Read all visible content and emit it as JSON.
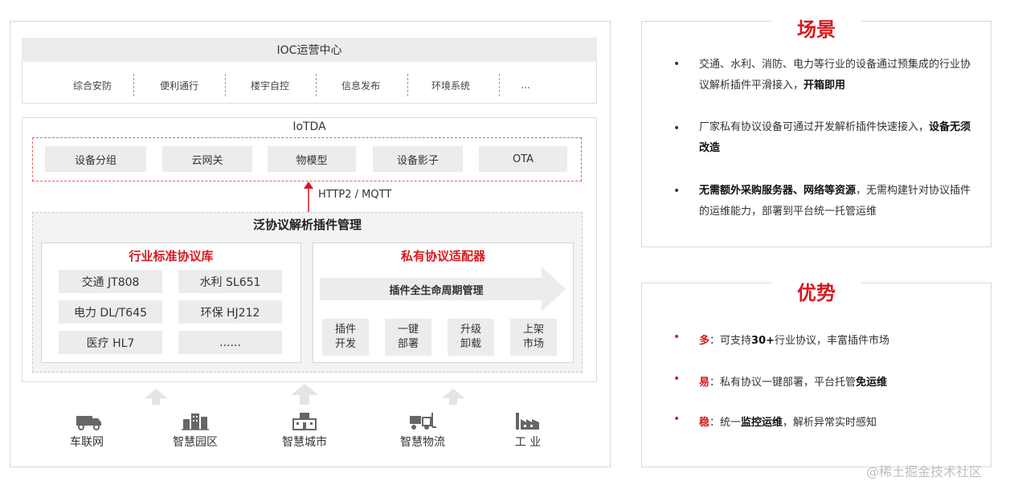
{
  "ioc": {
    "title": "IOC运营中心",
    "items": [
      "综合安防",
      "便利通行",
      "楼宇自控",
      "信息发布",
      "环境系统",
      "..."
    ]
  },
  "iotda": {
    "title": "IoTDA",
    "items": [
      "设备分组",
      "云网关",
      "物模型",
      "设备影子",
      "OTA"
    ]
  },
  "protocol_label": "HTTP2 / MQTT",
  "plugin_mgmt": {
    "title": "泛协议解析插件管理",
    "standard": {
      "title": "行业标准协议库",
      "items": [
        "交通 JT808",
        "水利 SL651",
        "电力 DL/T645",
        "环保 HJ212",
        "医疗 HL7",
        "......"
      ]
    },
    "private": {
      "title": "私有协议适配器",
      "lifecycle": "插件全生命周期管理",
      "steps": [
        {
          "line1": "插件",
          "line2": "开发"
        },
        {
          "line1": "一键",
          "line2": "部署"
        },
        {
          "line1": "升级",
          "line2": "卸载"
        },
        {
          "line1": "上架",
          "line2": "市场"
        }
      ]
    }
  },
  "industries": [
    {
      "label": "车联网",
      "icon": "truck-icon"
    },
    {
      "label": "智慧园区",
      "icon": "building-icon"
    },
    {
      "label": "智慧城市",
      "icon": "city-icon"
    },
    {
      "label": "智慧物流",
      "icon": "forklift-icon"
    },
    {
      "label": "工 业",
      "icon": "factory-icon"
    }
  ],
  "scene": {
    "title": "场景",
    "bullets": [
      {
        "text": "交通、水利、消防、电力等行业的设备通过预集成的行业协议解析插件平滑接入，",
        "bold": "开箱即用"
      },
      {
        "text": "厂家私有协议设备可通过开发解析插件快速接入，",
        "bold": "设备无须改造"
      },
      {
        "bold_lead": "无需额外采购服务器、网络等资源",
        "text": "，无需构建针对协议插件的运维能力，部署到平台统一托管运维"
      }
    ]
  },
  "advantages": {
    "title": "优势",
    "items": [
      {
        "key": "多",
        "pre": "：可支持",
        "bold": "30+",
        "post": "行业协议，丰富插件市场"
      },
      {
        "key": "易",
        "pre": "：私有协议一键部署，平台托管",
        "bold": "免运维",
        "post": ""
      },
      {
        "key": "稳",
        "pre": "：统一",
        "bold": "监控运维",
        "post": "，解析异常实时感知"
      }
    ]
  },
  "watermark": "@稀土掘金技术社区",
  "colors": {
    "accent": "#d7191f",
    "panel": "#ececec"
  }
}
